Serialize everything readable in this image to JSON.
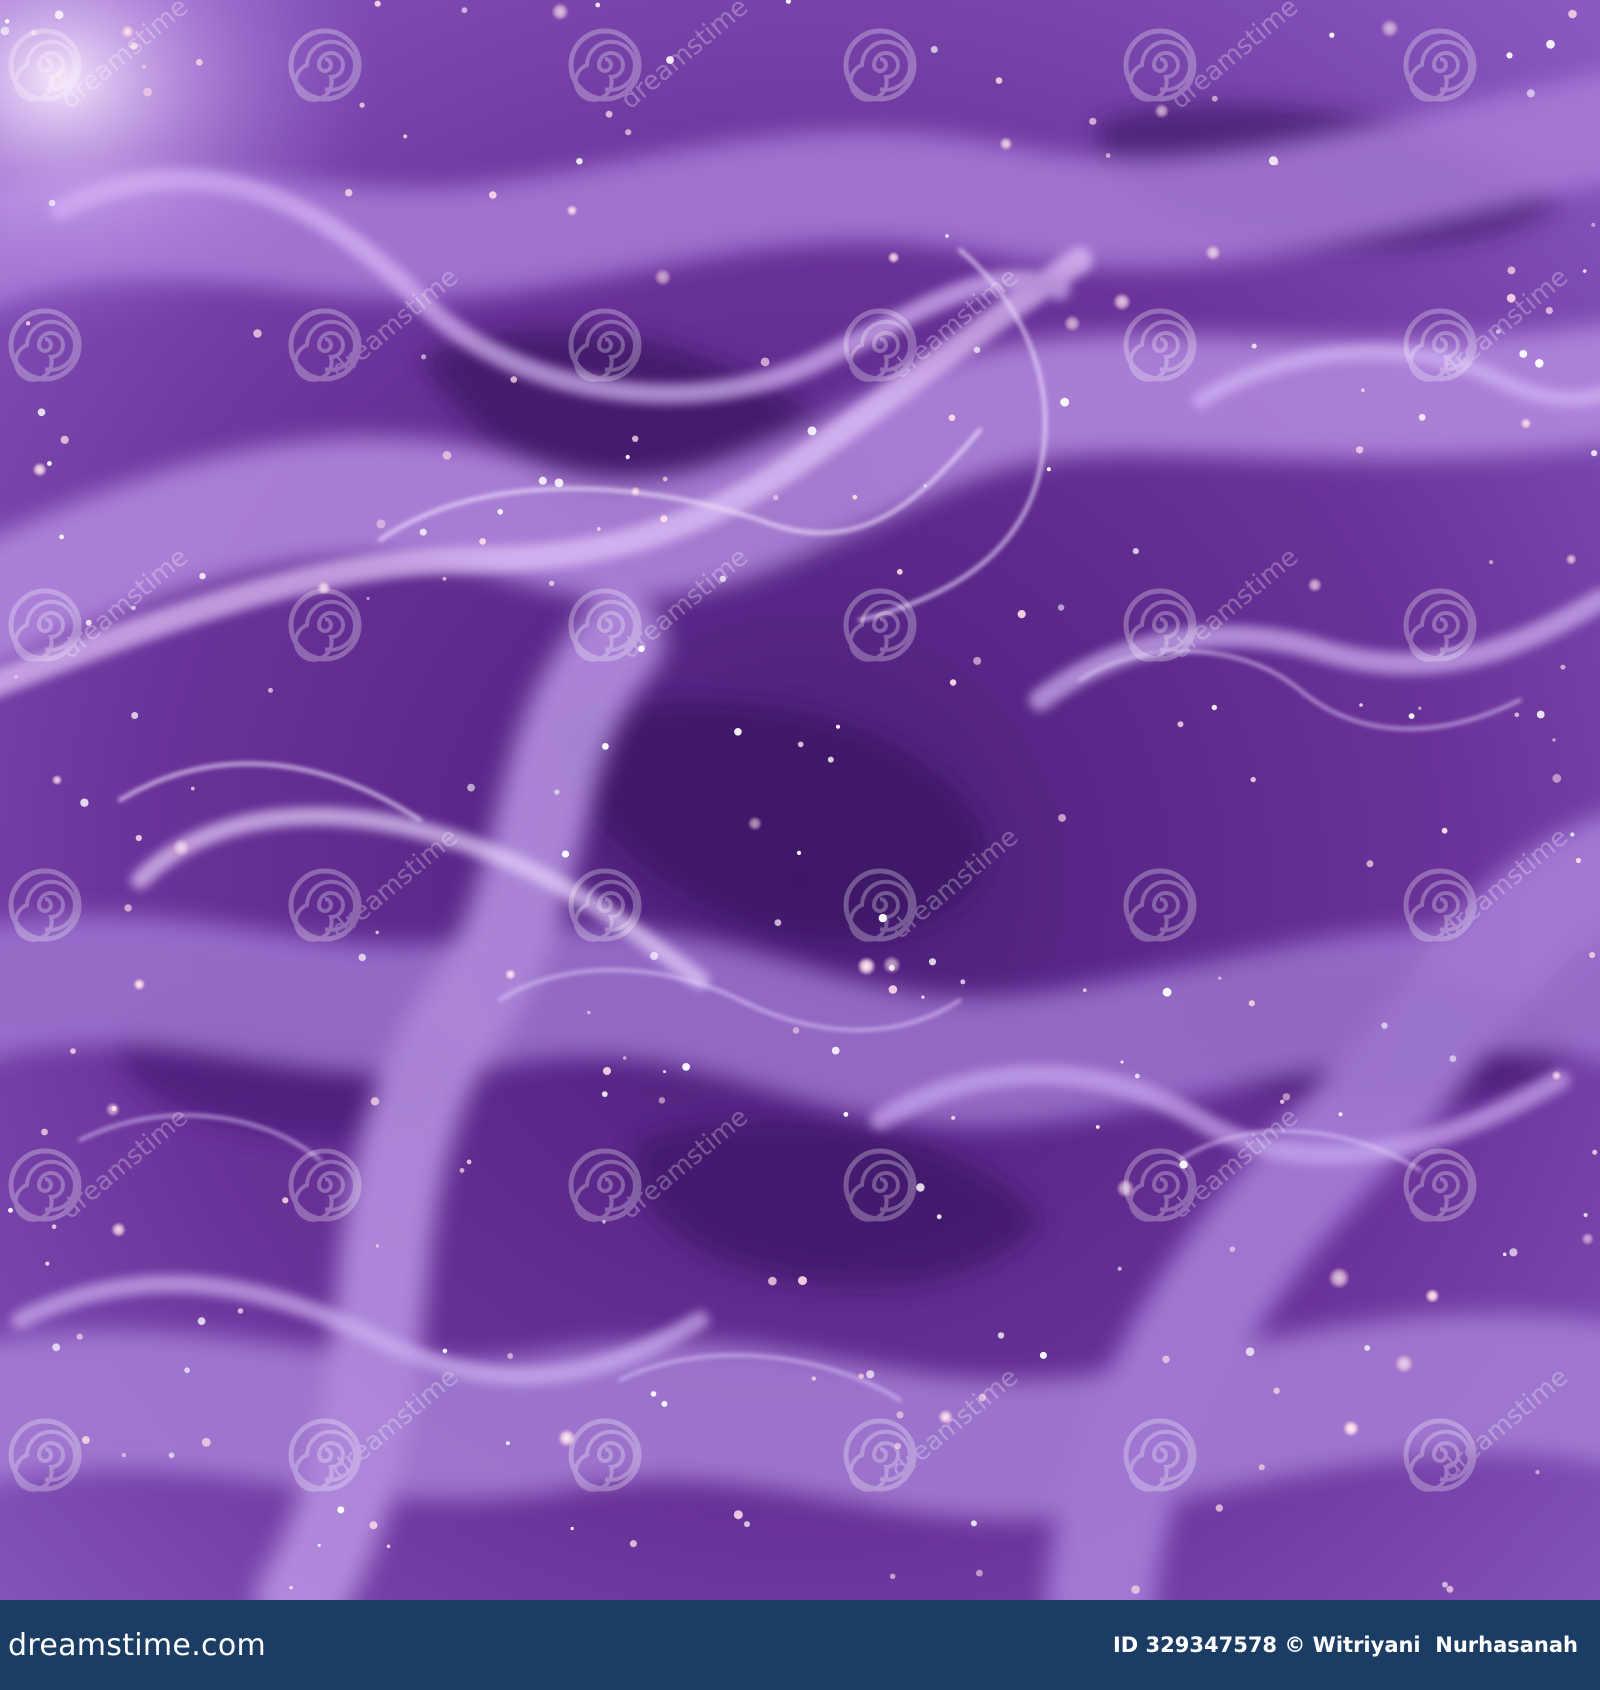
{
  "image": {
    "subject": "abstract purple silk waves with glitter",
    "colors": {
      "base": "#5c2a8a",
      "deep": "#3e1866",
      "lavender": "#b58ee0",
      "highlight": "#e6cdfb",
      "sparkle": "#ffe6ee",
      "footer": "#1b3d63"
    }
  },
  "watermark": {
    "text": "dreamstime",
    "icon": "spiral-logo-icon"
  },
  "footer": {
    "site_name": "dreamstime.com",
    "credit": "ID 329347578 © Witriyani  Nurhasanah"
  }
}
